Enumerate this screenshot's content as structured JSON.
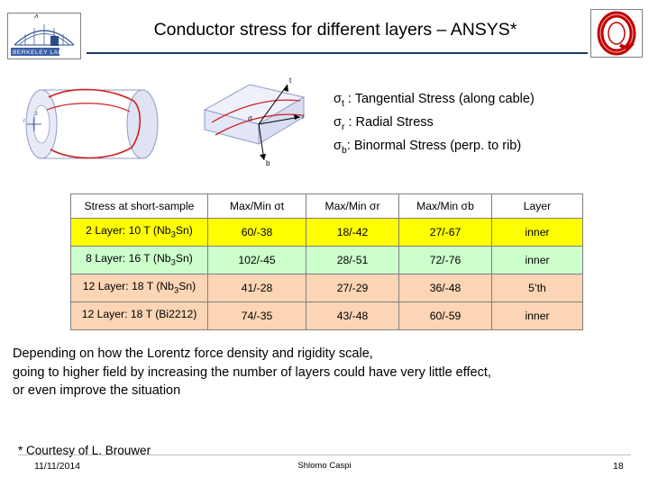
{
  "header": {
    "title": "Conductor stress for different layers – ANSYS*",
    "left_logo_text": "Berkeley Lab",
    "right_logo_name": "coil-logo"
  },
  "legend": {
    "lines": [
      {
        "symbol": "σ",
        "sub": "t",
        "text": " : Tangential  Stress (along cable)"
      },
      {
        "symbol": "σ",
        "sub": "r",
        "text": " : Radial Stress"
      },
      {
        "symbol": "σ",
        "sub": "b",
        "text": ":  Binormal  Stress (perp. to rib)"
      }
    ]
  },
  "table": {
    "headers": [
      "Stress at short-sample",
      "Max/Min σt",
      "Max/Min σr",
      "Max/Min σb",
      "Layer"
    ],
    "rows": [
      {
        "style": "yellow",
        "label_pre": "2 Layer:  10 T (Nb",
        "label_sub": "3",
        "label_post": "Sn)",
        "st": "60/-38",
        "sr": "18/-42",
        "sb": "27/-67",
        "layer": "inner"
      },
      {
        "style": "green",
        "label_pre": "8 Layer:  16 T (Nb",
        "label_sub": "3",
        "label_post": "Sn)",
        "st": "102/-45",
        "sr": "28/-51",
        "sb": "72/-76",
        "layer": "inner"
      },
      {
        "style": "peach",
        "label_pre": "12 Layer: 18 T (Nb",
        "label_sub": "3",
        "label_post": "Sn)",
        "st": "41/-28",
        "sr": "27/-29",
        "sb": "36/-48",
        "layer": "5’th"
      },
      {
        "style": "peach",
        "label_pre": "12 Layer: 18 T (Bi2212)",
        "label_sub": "",
        "label_post": "",
        "st": "74/-35",
        "sr": "43/-48",
        "sb": "60/-59",
        "layer": "inner"
      }
    ]
  },
  "body": {
    "line1": "Depending on how the Lorentz force density and rigidity scale,",
    "line2": "going to higher field by increasing the number of layers could have very little effect,",
    "line3": " or even improve the situation",
    "courtesy": "* Courtesy of  L. Brouwer"
  },
  "footer": {
    "date": "11/11/2014",
    "center": "Shlomo Caspi",
    "page": "18"
  },
  "colors": {
    "rule": "#1f3864",
    "row_yellow": "#ffff00",
    "row_green": "#ccffcc",
    "row_peach": "#fbd5b5",
    "logo_red": "#c00000"
  }
}
